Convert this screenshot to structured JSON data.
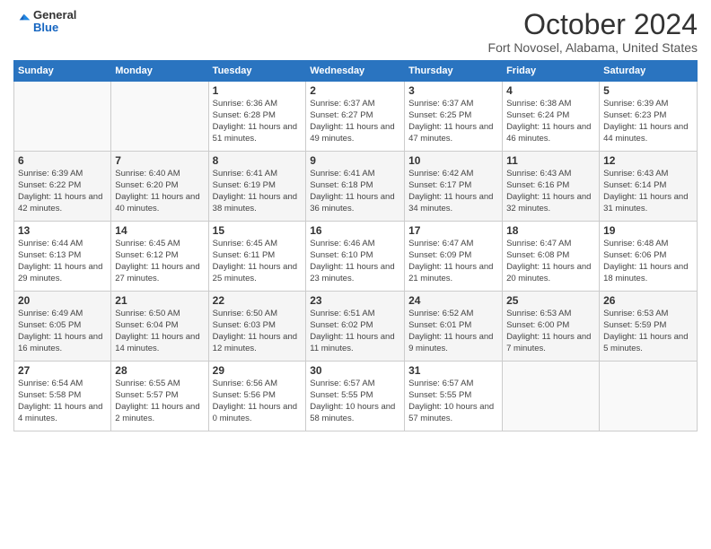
{
  "logo": {
    "line1": "General",
    "line2": "Blue",
    "arrow_color": "#1e88e5"
  },
  "title": "October 2024",
  "subtitle": "Fort Novosel, Alabama, United States",
  "days_of_week": [
    "Sunday",
    "Monday",
    "Tuesday",
    "Wednesday",
    "Thursday",
    "Friday",
    "Saturday"
  ],
  "weeks": [
    [
      {
        "day": "",
        "info": ""
      },
      {
        "day": "",
        "info": ""
      },
      {
        "day": "1",
        "info": "Sunrise: 6:36 AM\nSunset: 6:28 PM\nDaylight: 11 hours and 51 minutes."
      },
      {
        "day": "2",
        "info": "Sunrise: 6:37 AM\nSunset: 6:27 PM\nDaylight: 11 hours and 49 minutes."
      },
      {
        "day": "3",
        "info": "Sunrise: 6:37 AM\nSunset: 6:25 PM\nDaylight: 11 hours and 47 minutes."
      },
      {
        "day": "4",
        "info": "Sunrise: 6:38 AM\nSunset: 6:24 PM\nDaylight: 11 hours and 46 minutes."
      },
      {
        "day": "5",
        "info": "Sunrise: 6:39 AM\nSunset: 6:23 PM\nDaylight: 11 hours and 44 minutes."
      }
    ],
    [
      {
        "day": "6",
        "info": "Sunrise: 6:39 AM\nSunset: 6:22 PM\nDaylight: 11 hours and 42 minutes."
      },
      {
        "day": "7",
        "info": "Sunrise: 6:40 AM\nSunset: 6:20 PM\nDaylight: 11 hours and 40 minutes."
      },
      {
        "day": "8",
        "info": "Sunrise: 6:41 AM\nSunset: 6:19 PM\nDaylight: 11 hours and 38 minutes."
      },
      {
        "day": "9",
        "info": "Sunrise: 6:41 AM\nSunset: 6:18 PM\nDaylight: 11 hours and 36 minutes."
      },
      {
        "day": "10",
        "info": "Sunrise: 6:42 AM\nSunset: 6:17 PM\nDaylight: 11 hours and 34 minutes."
      },
      {
        "day": "11",
        "info": "Sunrise: 6:43 AM\nSunset: 6:16 PM\nDaylight: 11 hours and 32 minutes."
      },
      {
        "day": "12",
        "info": "Sunrise: 6:43 AM\nSunset: 6:14 PM\nDaylight: 11 hours and 31 minutes."
      }
    ],
    [
      {
        "day": "13",
        "info": "Sunrise: 6:44 AM\nSunset: 6:13 PM\nDaylight: 11 hours and 29 minutes."
      },
      {
        "day": "14",
        "info": "Sunrise: 6:45 AM\nSunset: 6:12 PM\nDaylight: 11 hours and 27 minutes."
      },
      {
        "day": "15",
        "info": "Sunrise: 6:45 AM\nSunset: 6:11 PM\nDaylight: 11 hours and 25 minutes."
      },
      {
        "day": "16",
        "info": "Sunrise: 6:46 AM\nSunset: 6:10 PM\nDaylight: 11 hours and 23 minutes."
      },
      {
        "day": "17",
        "info": "Sunrise: 6:47 AM\nSunset: 6:09 PM\nDaylight: 11 hours and 21 minutes."
      },
      {
        "day": "18",
        "info": "Sunrise: 6:47 AM\nSunset: 6:08 PM\nDaylight: 11 hours and 20 minutes."
      },
      {
        "day": "19",
        "info": "Sunrise: 6:48 AM\nSunset: 6:06 PM\nDaylight: 11 hours and 18 minutes."
      }
    ],
    [
      {
        "day": "20",
        "info": "Sunrise: 6:49 AM\nSunset: 6:05 PM\nDaylight: 11 hours and 16 minutes."
      },
      {
        "day": "21",
        "info": "Sunrise: 6:50 AM\nSunset: 6:04 PM\nDaylight: 11 hours and 14 minutes."
      },
      {
        "day": "22",
        "info": "Sunrise: 6:50 AM\nSunset: 6:03 PM\nDaylight: 11 hours and 12 minutes."
      },
      {
        "day": "23",
        "info": "Sunrise: 6:51 AM\nSunset: 6:02 PM\nDaylight: 11 hours and 11 minutes."
      },
      {
        "day": "24",
        "info": "Sunrise: 6:52 AM\nSunset: 6:01 PM\nDaylight: 11 hours and 9 minutes."
      },
      {
        "day": "25",
        "info": "Sunrise: 6:53 AM\nSunset: 6:00 PM\nDaylight: 11 hours and 7 minutes."
      },
      {
        "day": "26",
        "info": "Sunrise: 6:53 AM\nSunset: 5:59 PM\nDaylight: 11 hours and 5 minutes."
      }
    ],
    [
      {
        "day": "27",
        "info": "Sunrise: 6:54 AM\nSunset: 5:58 PM\nDaylight: 11 hours and 4 minutes."
      },
      {
        "day": "28",
        "info": "Sunrise: 6:55 AM\nSunset: 5:57 PM\nDaylight: 11 hours and 2 minutes."
      },
      {
        "day": "29",
        "info": "Sunrise: 6:56 AM\nSunset: 5:56 PM\nDaylight: 11 hours and 0 minutes."
      },
      {
        "day": "30",
        "info": "Sunrise: 6:57 AM\nSunset: 5:55 PM\nDaylight: 10 hours and 58 minutes."
      },
      {
        "day": "31",
        "info": "Sunrise: 6:57 AM\nSunset: 5:55 PM\nDaylight: 10 hours and 57 minutes."
      },
      {
        "day": "",
        "info": ""
      },
      {
        "day": "",
        "info": ""
      }
    ]
  ]
}
